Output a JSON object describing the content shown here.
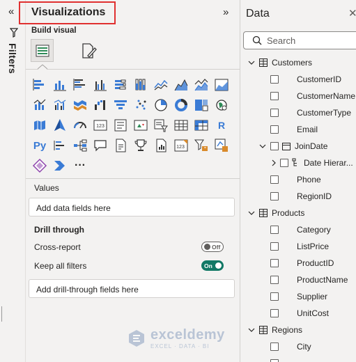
{
  "filters": {
    "label": "Filters"
  },
  "visualizations": {
    "title": "Visualizations",
    "build_visual_label": "Build visual",
    "icons": [
      "stacked-bar-chart",
      "stacked-column-chart",
      "clustered-bar-chart",
      "clustered-column-chart",
      "100-stacked-bar-chart",
      "100-stacked-column-chart",
      "line-chart",
      "area-chart",
      "stacked-area-chart",
      "100-stacked-area-chart",
      "line-and-stacked-column-chart",
      "line-and-clustered-column-chart",
      "ribbon-chart",
      "waterfall-chart",
      "funnel-chart",
      "scatter-chart",
      "pie-chart",
      "donut-chart",
      "treemap",
      "map",
      "filled-map",
      "azure-map",
      "gauge",
      "card",
      "multi-row-card",
      "kpi",
      "slicer",
      "table",
      "matrix",
      "r-script-visual",
      "python-visual",
      "key-influencers",
      "decomposition-tree",
      "qa",
      "smart-narrative",
      "goals",
      "paginated-report",
      "power-apps",
      "power-automate",
      "arcgis-map",
      "power-apps-diamond",
      "power-automate-chevron",
      "more-visuals"
    ],
    "r_label": "R",
    "py_label": "Py",
    "kpi_number": "123",
    "more_label": "···",
    "values_label": "Values",
    "values_placeholder": "Add data fields here",
    "drill_through_label": "Drill through",
    "cross_report_label": "Cross-report",
    "cross_report_toggle": "Off",
    "keep_filters_label": "Keep all filters",
    "keep_filters_toggle": "On",
    "drill_placeholder": "Add drill-through fields here"
  },
  "watermark": {
    "name": "exceldemy",
    "sub": "EXCEL · DATA · BI"
  },
  "data_pane": {
    "title": "Data",
    "search_placeholder": "Search",
    "tables": [
      {
        "name": "Customers",
        "fields": [
          "CustomerID",
          "CustomerName",
          "CustomerType",
          "Email"
        ],
        "hierarchy_field": "JoinDate",
        "hierarchy_child": "Date Hierar...",
        "fields_after": [
          "Phone",
          "RegionID"
        ]
      },
      {
        "name": "Products",
        "fields": [
          "Category",
          "ListPrice",
          "ProductID",
          "ProductName",
          "Supplier",
          "UnitCost"
        ]
      },
      {
        "name": "Regions",
        "fields": [
          "City"
        ]
      }
    ]
  },
  "colors": {
    "accent_toggle": "#117865",
    "highlight_border": "#e03030",
    "icon_blue": "#3a7bd5",
    "icon_orange": "#d98a2b"
  }
}
